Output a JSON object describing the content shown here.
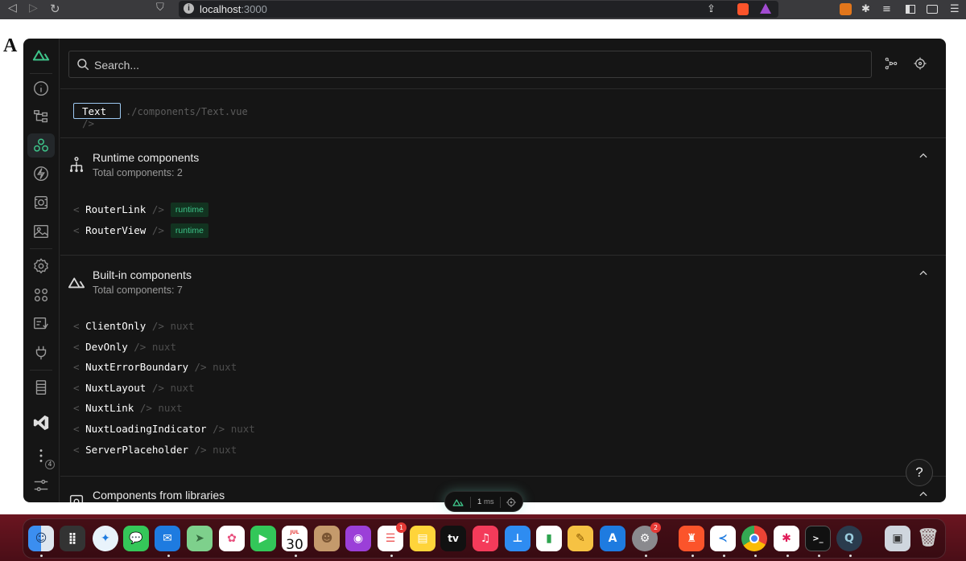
{
  "browser": {
    "url_host": "localhost",
    "url_port": ":3000",
    "nav_back": "◁",
    "nav_forward": "▷",
    "nav_reload": "↻",
    "bookmark": "⛉"
  },
  "page_letter": "A",
  "search": {
    "placeholder": "Search..."
  },
  "selected": {
    "tag": "Text",
    "open_bracket": "<",
    "close": "/>",
    "path": "./components/Text.vue"
  },
  "sections": [
    {
      "title": "Runtime components",
      "subtitle": "Total components: 2",
      "items": [
        {
          "name": "RouterLink",
          "badge": "runtime"
        },
        {
          "name": "RouterView",
          "badge": "runtime"
        }
      ]
    },
    {
      "title": "Built-in components",
      "subtitle": "Total components: 7",
      "items": [
        {
          "name": "ClientOnly",
          "source": "nuxt"
        },
        {
          "name": "DevOnly",
          "source": "nuxt"
        },
        {
          "name": "NuxtErrorBoundary",
          "source": "nuxt"
        },
        {
          "name": "NuxtLayout",
          "source": "nuxt"
        },
        {
          "name": "NuxtLink",
          "source": "nuxt"
        },
        {
          "name": "NuxtLoadingIndicator",
          "source": "nuxt"
        },
        {
          "name": "ServerPlaceholder",
          "source": "nuxt"
        }
      ]
    },
    {
      "title": "Components from libraries"
    }
  ],
  "sidebar_badge": "4",
  "help": "?",
  "floating": {
    "value": "1",
    "unit": "ms"
  },
  "dock": {
    "calendar_month": "JUL",
    "calendar_day": "30",
    "reminders_badge": "1",
    "settings_badge": "2",
    "tv_label": "tv"
  },
  "colors": {
    "accent": "#3ec48a",
    "panel": "#151515",
    "dock": "#6b1520"
  }
}
